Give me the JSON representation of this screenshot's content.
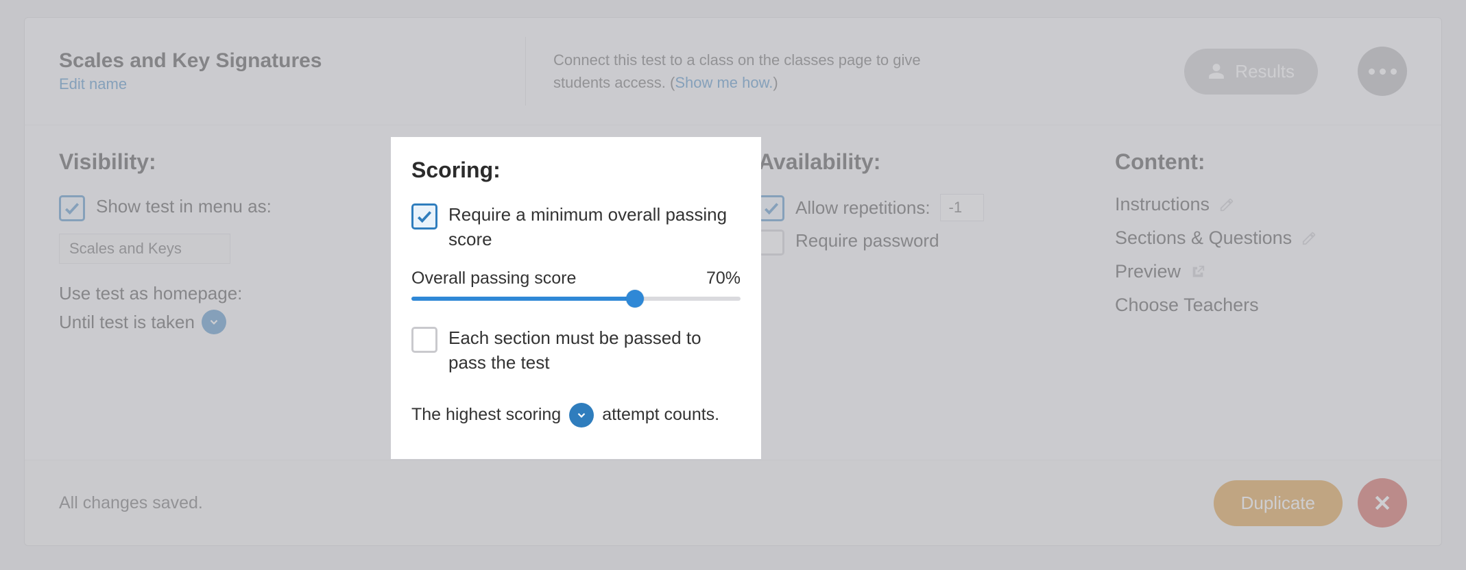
{
  "header": {
    "title": "Scales and Key Signatures",
    "edit_name": "Edit name",
    "connect_prefix": "Connect this test to a class on the classes page to give students access. (",
    "connect_link": "Show me how.",
    "connect_suffix": ")",
    "results_label": "Results"
  },
  "visibility": {
    "heading": "Visibility:",
    "show_in_menu": "Show test in menu as:",
    "menu_name": "Scales and Keys",
    "use_as_homepage_label": "Use test as homepage:",
    "homepage_value": "Until test is taken"
  },
  "scoring": {
    "heading": "Scoring:",
    "require_min": "Require a minimum overall passing score",
    "overall_label": "Overall passing score",
    "overall_pct": "70%",
    "each_section": "Each section must be passed to pass the test",
    "attempt_prefix": "The highest scoring",
    "attempt_suffix": "attempt counts."
  },
  "availability": {
    "heading": "Availability:",
    "allow_repetitions": "Allow repetitions:",
    "repetitions_value": "-1",
    "require_password": "Require password"
  },
  "content": {
    "heading": "Content:",
    "instructions": "Instructions",
    "sections": "Sections & Questions",
    "preview": "Preview",
    "choose_teachers": "Choose Teachers"
  },
  "footer": {
    "status": "All changes saved.",
    "duplicate": "Duplicate"
  }
}
